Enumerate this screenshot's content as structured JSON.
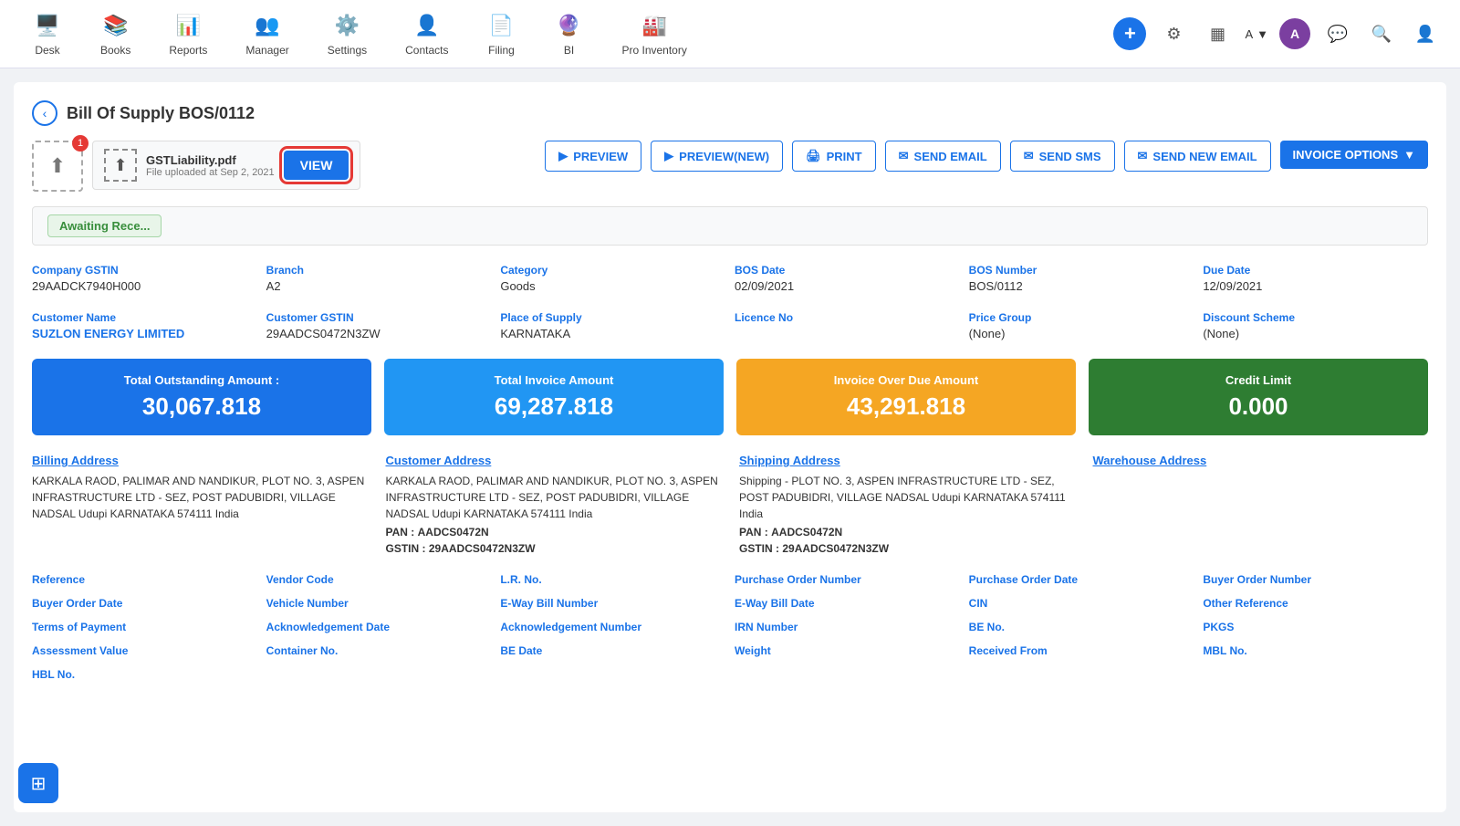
{
  "nav": {
    "items": [
      {
        "id": "desk",
        "label": "Desk",
        "icon": "🖥️"
      },
      {
        "id": "books",
        "label": "Books",
        "icon": "📚"
      },
      {
        "id": "reports",
        "label": "Reports",
        "icon": "📊"
      },
      {
        "id": "manager",
        "label": "Manager",
        "icon": "👥"
      },
      {
        "id": "settings",
        "label": "Settings",
        "icon": "⚙️"
      },
      {
        "id": "contacts",
        "label": "Contacts",
        "icon": "👤"
      },
      {
        "id": "filing",
        "label": "Filing",
        "icon": "📄"
      },
      {
        "id": "bi",
        "label": "BI",
        "icon": "🔮"
      },
      {
        "id": "pro-inventory",
        "label": "Pro Inventory",
        "icon": "🏭"
      }
    ],
    "user_label": "A",
    "user_dropdown": "▼"
  },
  "page": {
    "title": "Bill Of Supply BOS/0112",
    "back_label": "‹"
  },
  "toolbar": {
    "preview_label": "PREVIEW",
    "preview_new_label": "PREVIEW(NEW)",
    "print_label": "PRINT",
    "send_email_label": "SEND EMAIL",
    "send_sms_label": "SEND SMS",
    "send_new_email_label": "SEND NEW EMAIL",
    "invoice_options_label": "INVOICE OPTIONS"
  },
  "file_attachment": {
    "name": "GSTLiability.pdf",
    "date": "File uploaded at Sep 2, 2021",
    "view_label": "VIEW",
    "badge": "1"
  },
  "status": {
    "badge_label": "Awaiting Rece..."
  },
  "fields": {
    "company_gstin_label": "Company GSTIN",
    "company_gstin_value": "29AADCK7940H000",
    "branch_label": "Branch",
    "branch_value": "A2",
    "category_label": "Category",
    "category_value": "Goods",
    "bos_date_label": "BOS Date",
    "bos_date_value": "02/09/2021",
    "bos_number_label": "BOS Number",
    "bos_number_value": "BOS/0112",
    "due_date_label": "Due Date",
    "due_date_value": "12/09/2021",
    "customer_name_label": "Customer Name",
    "customer_name_value": "SUZLON ENERGY LIMITED",
    "customer_gstin_label": "Customer GSTIN",
    "customer_gstin_value": "29AADCS0472N3ZW",
    "place_of_supply_label": "Place of Supply",
    "place_of_supply_value": "KARNATAKA",
    "licence_no_label": "Licence No",
    "licence_no_value": "",
    "price_group_label": "Price Group",
    "price_group_value": "(None)",
    "discount_scheme_label": "Discount Scheme",
    "discount_scheme_value": "(None)"
  },
  "summary_cards": [
    {
      "id": "total-outstanding",
      "title": "Total Outstanding Amount :",
      "value": "30,067.818",
      "color": "card-blue"
    },
    {
      "id": "total-invoice",
      "title": "Total Invoice Amount",
      "value": "69,287.818",
      "color": "card-blue2"
    },
    {
      "id": "overdue",
      "title": "Invoice Over Due Amount",
      "value": "43,291.818",
      "color": "card-orange"
    },
    {
      "id": "credit-limit",
      "title": "Credit Limit",
      "value": "0.000",
      "color": "card-green"
    }
  ],
  "addresses": {
    "billing": {
      "label": "Billing Address",
      "text": "KARKALA RAOD, PALIMAR AND NANDIKUR, PLOT NO. 3, ASPEN INFRASTRUCTURE LTD - SEZ, POST PADUBIDRI, VILLAGE NADSAL Udupi KARNATAKA 574111 India"
    },
    "customer": {
      "label": "Customer Address",
      "text": "KARKALA RAOD, PALIMAR AND NANDIKUR, PLOT NO. 3, ASPEN INFRASTRUCTURE LTD - SEZ, POST PADUBIDRI, VILLAGE NADSAL Udupi KARNATAKA 574111 India",
      "pan_label": "PAN :",
      "pan_value": "AADCS0472N",
      "gstin_label": "GSTIN :",
      "gstin_value": "29AADCS0472N3ZW"
    },
    "shipping": {
      "label": "Shipping Address",
      "text": "Shipping - PLOT NO. 3, ASPEN INFRASTRUCTURE LTD - SEZ, POST PADUBIDRI, VILLAGE NADSAL Udupi KARNATAKA 574111 India",
      "pan_label": "PAN :",
      "pan_value": "AADCS0472N",
      "gstin_label": "GSTIN :",
      "gstin_value": "29AADCS0472N3ZW"
    },
    "warehouse": {
      "label": "Warehouse Address"
    }
  },
  "ref_fields": [
    {
      "id": "reference",
      "label": "Reference"
    },
    {
      "id": "vendor-code",
      "label": "Vendor Code"
    },
    {
      "id": "lr-no",
      "label": "L.R. No."
    },
    {
      "id": "purchase-order-number",
      "label": "Purchase Order Number"
    },
    {
      "id": "purchase-order-date",
      "label": "Purchase Order Date"
    },
    {
      "id": "buyer-order-number",
      "label": "Buyer Order Number"
    },
    {
      "id": "buyer-order-date",
      "label": "Buyer Order Date"
    },
    {
      "id": "vehicle-number",
      "label": "Vehicle Number"
    },
    {
      "id": "e-way-bill-number",
      "label": "E-Way Bill Number"
    },
    {
      "id": "e-way-bill-date",
      "label": "E-Way Bill Date"
    },
    {
      "id": "cin",
      "label": "CIN"
    },
    {
      "id": "other-reference",
      "label": "Other Reference"
    },
    {
      "id": "terms-of-payment",
      "label": "Terms of Payment"
    },
    {
      "id": "acknowledgement-date",
      "label": "Acknowledgement Date"
    },
    {
      "id": "acknowledgement-number",
      "label": "Acknowledgement Number"
    },
    {
      "id": "irn-number",
      "label": "IRN Number"
    },
    {
      "id": "be-no",
      "label": "BE No."
    },
    {
      "id": "pkgs",
      "label": "PKGS"
    },
    {
      "id": "assessment-value",
      "label": "Assessment Value"
    },
    {
      "id": "container-no",
      "label": "Container No."
    },
    {
      "id": "be-date",
      "label": "BE Date"
    },
    {
      "id": "weight",
      "label": "Weight"
    },
    {
      "id": "received-from",
      "label": "Received From"
    },
    {
      "id": "mbl-no",
      "label": "MBL No."
    },
    {
      "id": "hbl-no",
      "label": "HBL No."
    }
  ]
}
